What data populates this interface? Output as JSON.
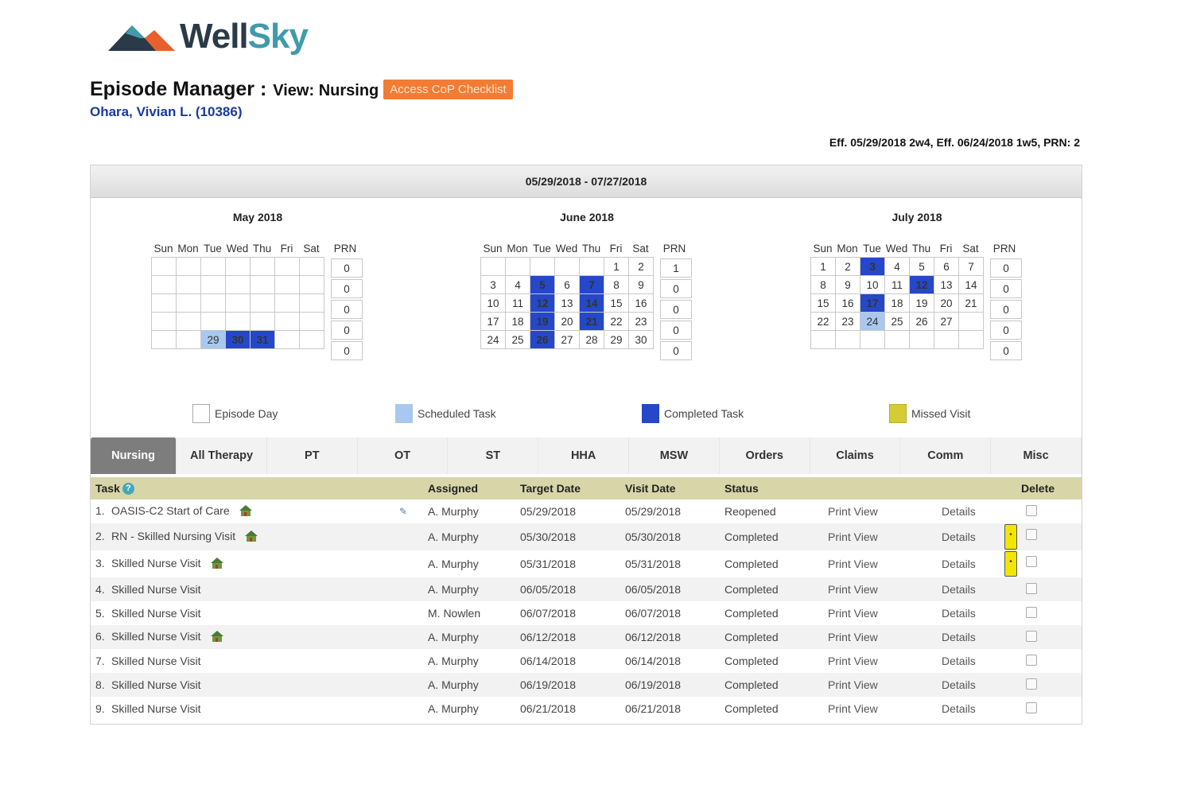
{
  "logo": {
    "word1": "Well",
    "word2": "Sky"
  },
  "header": {
    "title": "Episode Manager :",
    "view": "View: Nursing",
    "cop_button": "Access CoP Checklist",
    "patient": "Ohara, Vivian L. (10386)",
    "frequency": "Eff. 05/29/2018 2w4, Eff. 06/24/2018 1w5, PRN: 2"
  },
  "episode_period": "05/29/2018 - 07/27/2018",
  "day_headers": [
    "Sun",
    "Mon",
    "Tue",
    "Wed",
    "Thu",
    "Fri",
    "Sat"
  ],
  "prn_header": "PRN",
  "months": [
    {
      "title": "May 2018",
      "weeks": [
        [
          "",
          "",
          "",
          "",
          "",
          "",
          ""
        ],
        [
          "",
          "",
          "",
          "",
          "",
          "",
          ""
        ],
        [
          "",
          "",
          "",
          "",
          "",
          "",
          ""
        ],
        [
          "",
          "",
          "",
          "",
          "",
          "",
          ""
        ],
        [
          "",
          "",
          "29",
          "30",
          "31",
          "",
          ""
        ]
      ],
      "scheduled": [
        "29"
      ],
      "completed": [
        "30",
        "31"
      ],
      "prn": [
        "0",
        "0",
        "0",
        "0",
        "0"
      ]
    },
    {
      "title": "June 2018",
      "weeks": [
        [
          "",
          "",
          "",
          "",
          "",
          "1",
          "2"
        ],
        [
          "3",
          "4",
          "5",
          "6",
          "7",
          "8",
          "9"
        ],
        [
          "10",
          "11",
          "12",
          "13",
          "14",
          "15",
          "16"
        ],
        [
          "17",
          "18",
          "19",
          "20",
          "21",
          "22",
          "23"
        ],
        [
          "24",
          "25",
          "26",
          "27",
          "28",
          "29",
          "30"
        ]
      ],
      "scheduled": [],
      "completed": [
        "5",
        "7",
        "12",
        "14",
        "19",
        "21",
        "26"
      ],
      "prn": [
        "1",
        "0",
        "0",
        "0",
        "0"
      ]
    },
    {
      "title": "July 2018",
      "weeks": [
        [
          "1",
          "2",
          "3",
          "4",
          "5",
          "6",
          "7"
        ],
        [
          "8",
          "9",
          "10",
          "11",
          "12",
          "13",
          "14"
        ],
        [
          "15",
          "16",
          "17",
          "18",
          "19",
          "20",
          "21"
        ],
        [
          "22",
          "23",
          "24",
          "25",
          "26",
          "27",
          ""
        ],
        [
          "",
          "",
          "",
          "",
          "",
          "",
          ""
        ]
      ],
      "scheduled": [
        "24"
      ],
      "completed": [
        "3",
        "12",
        "17"
      ],
      "prn": [
        "0",
        "0",
        "0",
        "0",
        "0"
      ]
    }
  ],
  "legend": [
    {
      "label": "Episode Day",
      "color": "#ffffff"
    },
    {
      "label": "Scheduled Task",
      "color": "#a9c8ef"
    },
    {
      "label": "Completed Task",
      "color": "#2548c8"
    },
    {
      "label": "Missed Visit",
      "color": "#d4cc33"
    }
  ],
  "tabs": [
    "Nursing",
    "All Therapy",
    "PT",
    "OT",
    "ST",
    "HHA",
    "MSW",
    "Orders",
    "Claims",
    "Comm",
    "Misc"
  ],
  "table": {
    "headers": {
      "task": "Task",
      "assigned": "Assigned",
      "target": "Target Date",
      "visit": "Visit Date",
      "status": "Status",
      "delete": "Delete"
    },
    "rows": [
      {
        "num": "1.",
        "task": "OASIS-C2 Start of Care",
        "house": true,
        "edit": true,
        "assigned": "A. Murphy",
        "target": "05/29/2018",
        "visit": "05/29/2018",
        "status": "Reopened",
        "print": "Print View",
        "details": "Details",
        "note": false
      },
      {
        "num": "2.",
        "task": "RN - Skilled Nursing Visit",
        "house": true,
        "edit": false,
        "assigned": "A. Murphy",
        "target": "05/30/2018",
        "visit": "05/30/2018",
        "status": "Completed",
        "print": "Print View",
        "details": "Details",
        "note": true
      },
      {
        "num": "3.",
        "task": "Skilled Nurse Visit",
        "house": true,
        "edit": false,
        "assigned": "A. Murphy",
        "target": "05/31/2018",
        "visit": "05/31/2018",
        "status": "Completed",
        "print": "Print View",
        "details": "Details",
        "note": true
      },
      {
        "num": "4.",
        "task": "Skilled Nurse Visit",
        "house": false,
        "edit": false,
        "assigned": "A. Murphy",
        "target": "06/05/2018",
        "visit": "06/05/2018",
        "status": "Completed",
        "print": "Print View",
        "details": "Details",
        "note": false
      },
      {
        "num": "5.",
        "task": "Skilled Nurse Visit",
        "house": false,
        "edit": false,
        "assigned": "M. Nowlen",
        "target": "06/07/2018",
        "visit": "06/07/2018",
        "status": "Completed",
        "print": "Print View",
        "details": "Details",
        "note": false
      },
      {
        "num": "6.",
        "task": "Skilled Nurse Visit",
        "house": true,
        "edit": false,
        "assigned": "A. Murphy",
        "target": "06/12/2018",
        "visit": "06/12/2018",
        "status": "Completed",
        "print": "Print View",
        "details": "Details",
        "note": false
      },
      {
        "num": "7.",
        "task": "Skilled Nurse Visit",
        "house": false,
        "edit": false,
        "assigned": "A. Murphy",
        "target": "06/14/2018",
        "visit": "06/14/2018",
        "status": "Completed",
        "print": "Print View",
        "details": "Details",
        "note": false
      },
      {
        "num": "8.",
        "task": "Skilled Nurse Visit",
        "house": false,
        "edit": false,
        "assigned": "A. Murphy",
        "target": "06/19/2018",
        "visit": "06/19/2018",
        "status": "Completed",
        "print": "Print View",
        "details": "Details",
        "note": false
      },
      {
        "num": "9.",
        "task": "Skilled Nurse Visit",
        "house": false,
        "edit": false,
        "assigned": "A. Murphy",
        "target": "06/21/2018",
        "visit": "06/21/2018",
        "status": "Completed",
        "print": "Print View",
        "details": "Details",
        "note": false
      }
    ]
  }
}
